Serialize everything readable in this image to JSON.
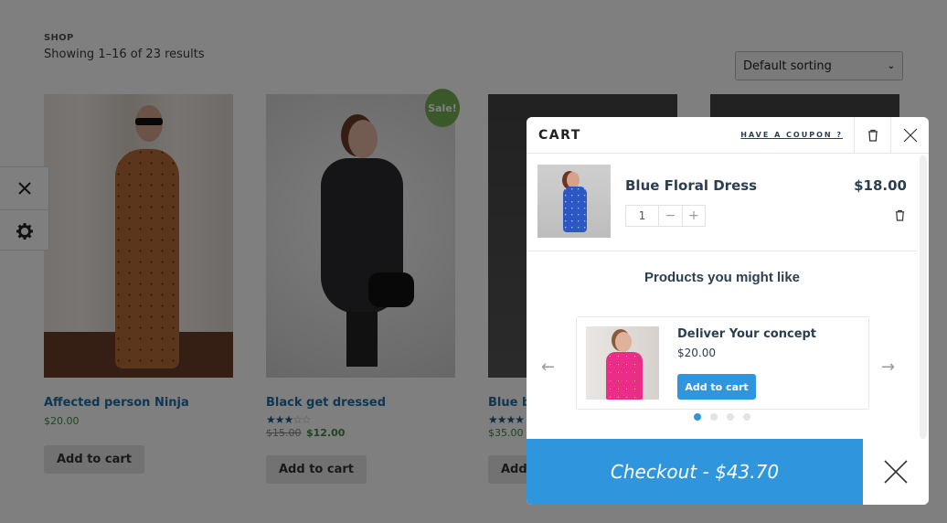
{
  "shop": {
    "section_label": "SHOP",
    "result_count": "Showing 1–16 of 23 results",
    "sort": {
      "selected": "Default sorting"
    },
    "sale_badge": "Sale!",
    "products": [
      {
        "title": "Affected person Ninja",
        "price": "$20.00",
        "button": "Add to cart"
      },
      {
        "title": "Black get dressed",
        "rating": 3,
        "rating_max": 5,
        "old_price": "$15.00",
        "price": "$12.00",
        "on_sale": true,
        "button": "Add to cart"
      },
      {
        "title": "Blue b",
        "rating": 4,
        "rating_max": 5,
        "price": "$35.00",
        "button": "Add"
      }
    ]
  },
  "side_panel": {
    "icons": [
      "close-icon",
      "gear-icon"
    ]
  },
  "cart": {
    "title": "CART",
    "coupon_link": "HAVE A COUPON ?",
    "items": [
      {
        "name": "Blue Floral Dress",
        "price": "$18.00",
        "quantity": "1",
        "minus": "−",
        "plus": "+"
      }
    ],
    "upsell": {
      "title": "Products you might like",
      "prev": "←",
      "next": "→",
      "product": {
        "name": "Deliver Your concept",
        "price": "$20.00",
        "button": "Add to cart"
      },
      "pages": 4,
      "active_page": 1
    },
    "checkout_label": "Checkout - $43.70"
  }
}
